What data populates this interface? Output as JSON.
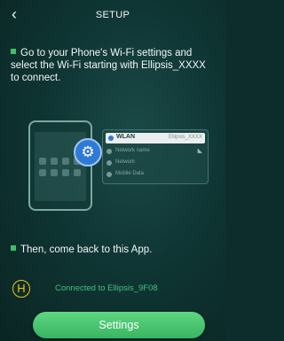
{
  "header": {
    "title": "SETUP",
    "back_icon": "chevron-left-icon"
  },
  "steps": [
    {
      "text": "Go to your Phone's Wi-Fi settings and select the Wi-Fi starting with Ellipsis_XXXX to connect."
    },
    {
      "text": "Then, come back to this App."
    }
  ],
  "illustration": {
    "gear_icon": "gear-icon",
    "wifi_list": {
      "header_label": "WLAN",
      "header_network": "Ellipsis_XXXX",
      "networks": [
        {
          "label": "Network name"
        },
        {
          "label": "Network"
        },
        {
          "label": "Mobile Data"
        }
      ]
    }
  },
  "status": {
    "icon_letter": "H",
    "text": "Connected to Ellipsis_9F08"
  },
  "settings_button": {
    "label": "Settings"
  },
  "colors": {
    "accent_green": "#3fbf6b",
    "status_green": "#48c07a",
    "icon_yellow": "#f0c419",
    "gear_blue": "#2f7ad6"
  }
}
